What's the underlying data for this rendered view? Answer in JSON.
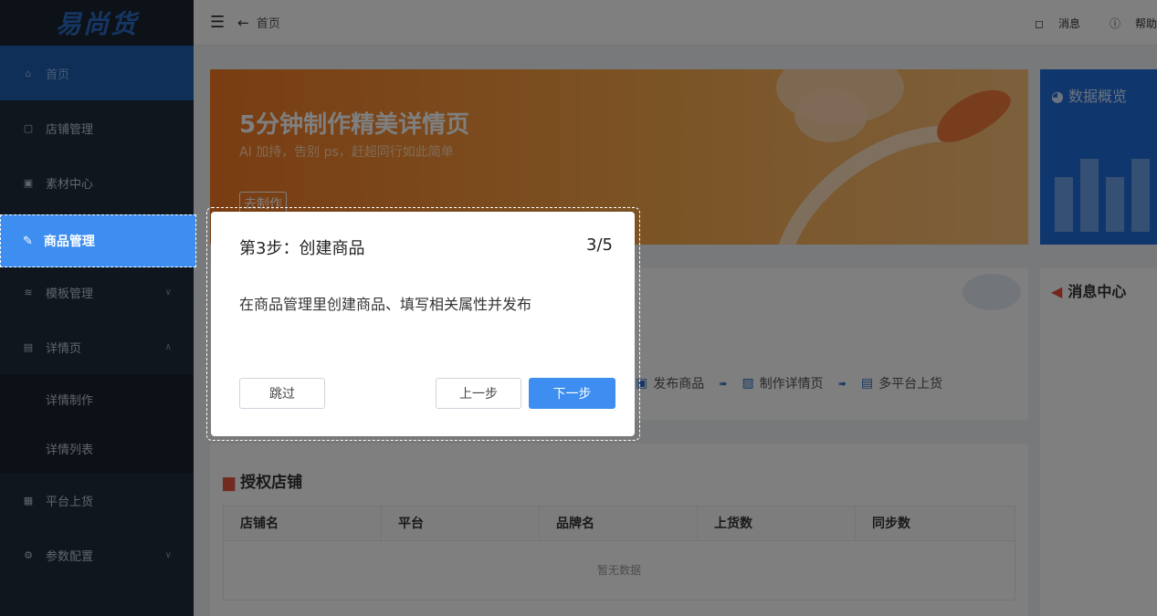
{
  "app": {
    "logo": "易尚货"
  },
  "topbar": {
    "breadcrumb": "首页",
    "messages": "消息",
    "help": "帮助"
  },
  "sidebar": {
    "items": [
      {
        "label": "首页",
        "icon": "home-icon"
      },
      {
        "label": "店铺管理",
        "icon": "shop-icon"
      },
      {
        "label": "素材中心",
        "icon": "image-icon"
      },
      {
        "label": "商品管理",
        "icon": "edit-icon"
      },
      {
        "label": "模板管理",
        "icon": "layers-icon"
      },
      {
        "label": "详情页",
        "icon": "file-icon"
      },
      {
        "label": "详情制作"
      },
      {
        "label": "详情列表"
      },
      {
        "label": "平台上货",
        "icon": "upload-icon"
      },
      {
        "label": "参数配置",
        "icon": "settings-icon"
      }
    ]
  },
  "banner": {
    "title": "5分钟制作精美详情页",
    "subtitle": "AI 加持，告别 ps，赶超同行如此简单",
    "button": "去制作"
  },
  "overview": {
    "title": "数据概览"
  },
  "message_center": {
    "title": "消息中心"
  },
  "process": {
    "steps": [
      "发布商品",
      "制作详情页",
      "多平台上货"
    ]
  },
  "shops": {
    "title": "授权店铺",
    "columns": [
      "店铺名",
      "平台",
      "品牌名",
      "上货数",
      "同步数"
    ],
    "empty": "暂无数据"
  },
  "guide": {
    "title": "第3步：创建商品",
    "progress": "3/5",
    "description": "在商品管理里创建商品、填写相关属性并发布",
    "skip": "跳过",
    "prev": "上一步",
    "next": "下一步"
  }
}
